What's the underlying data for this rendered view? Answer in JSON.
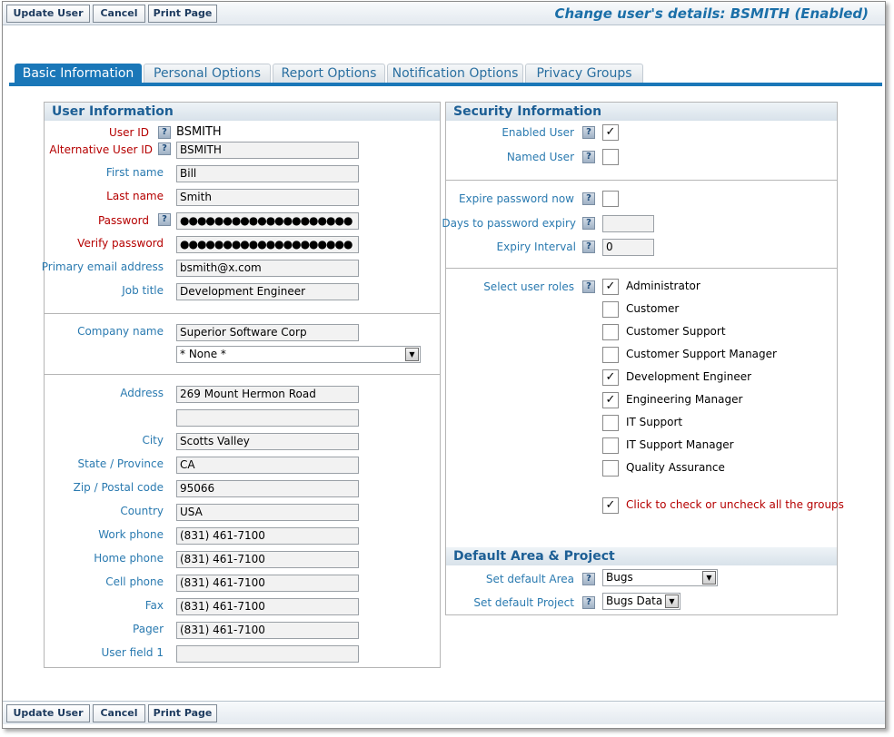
{
  "toolbar": {
    "update_label": "Update User",
    "cancel_label": "Cancel",
    "print_label": "Print Page"
  },
  "page_title": "Change user's details: BSMITH (Enabled)",
  "tabs": [
    {
      "label": "Basic Information"
    },
    {
      "label": "Personal Options"
    },
    {
      "label": "Report Options"
    },
    {
      "label": "Notification Options"
    },
    {
      "label": "Privacy Groups"
    }
  ],
  "user_info": {
    "heading": "User Information",
    "user_id_label": "User ID",
    "user_id_value": "BSMITH",
    "alt_user_id_label": "Alternative User ID",
    "alt_user_id_value": "BSMITH",
    "first_name_label": "First name",
    "first_name_value": "Bill",
    "last_name_label": "Last name",
    "last_name_value": "Smith",
    "password_label": "Password",
    "password_value": "●●●●●●●●●●●●●●●●●●●●",
    "verify_password_label": "Verify password",
    "verify_password_value": "●●●●●●●●●●●●●●●●●●●●",
    "email_label": "Primary email address",
    "email_value": "bsmith@x.com",
    "job_title_label": "Job title",
    "job_title_value": "Development Engineer"
  },
  "company": {
    "company_label": "Company name",
    "company_value": "Superior Software Corp",
    "company_select_value": "* None *"
  },
  "address": {
    "address_label": "Address",
    "address_line1": "269 Mount Hermon Road",
    "address_line2": "",
    "city_label": "City",
    "city_value": "Scotts Valley",
    "state_label": "State / Province",
    "state_value": "CA",
    "zip_label": "Zip / Postal code",
    "zip_value": "95066",
    "country_label": "Country",
    "country_value": "USA",
    "work_phone_label": "Work phone",
    "work_phone_value": "(831) 461-7100",
    "home_phone_label": "Home phone",
    "home_phone_value": "(831) 461-7100",
    "cell_phone_label": "Cell phone",
    "cell_phone_value": "(831) 461-7100",
    "fax_label": "Fax",
    "fax_value": "(831) 461-7100",
    "pager_label": "Pager",
    "pager_value": "(831) 461-7100",
    "user_field1_label": "User field 1",
    "user_field1_value": ""
  },
  "security": {
    "heading": "Security Information",
    "enabled_label": "Enabled User",
    "enabled_checked": "✓",
    "named_label": "Named User",
    "named_checked": "",
    "expire_now_label": "Expire password now",
    "expire_now_checked": "",
    "days_expiry_label": "Days to password expiry",
    "days_expiry_value": "",
    "expiry_interval_label": "Expiry Interval",
    "expiry_interval_value": "0"
  },
  "roles": {
    "label": "Select user roles",
    "items": [
      {
        "name": "Administrator",
        "mark": "✓"
      },
      {
        "name": "Customer",
        "mark": ""
      },
      {
        "name": "Customer Support",
        "mark": ""
      },
      {
        "name": "Customer Support Manager",
        "mark": ""
      },
      {
        "name": "Development Engineer",
        "mark": "✓"
      },
      {
        "name": "Engineering Manager",
        "mark": "✓"
      },
      {
        "name": "IT Support",
        "mark": ""
      },
      {
        "name": "IT Support Manager",
        "mark": ""
      },
      {
        "name": "Quality Assurance",
        "mark": ""
      }
    ],
    "toggle_all_label": "Click to check or uncheck all the groups",
    "toggle_all_mark": "✓"
  },
  "defaults": {
    "heading": "Default Area & Project",
    "area_label": "Set default Area",
    "area_value": "Bugs",
    "project_label": "Set default Project",
    "project_value": "Bugs Data"
  },
  "icons": {
    "help": "?",
    "dropdown": "▼"
  },
  "colors": {
    "accent": "#1a77b8",
    "label_blue": "#2a7ab0",
    "label_required": "#b50000"
  }
}
